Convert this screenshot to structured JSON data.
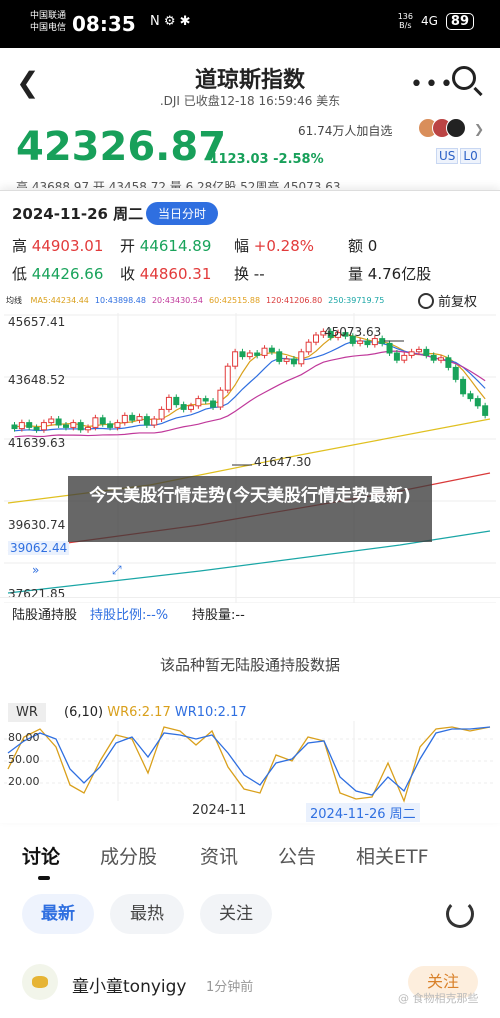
{
  "status_bar": {
    "carrier1": "中国联通",
    "carrier2": "中国电信",
    "time": "08:35",
    "icons": "N ⚙ ✱",
    "net_speed_top": "136",
    "net_speed_bottom": "B/s",
    "signal": "4G",
    "battery": "89"
  },
  "header": {
    "title": "道琼斯指数",
    "subtitle": ".DJI 已收盘12-18 16:59:46 美东"
  },
  "quote": {
    "price": "42326.87",
    "change": "-1123.03 -2.58%",
    "watchers": "61.74万人加自选",
    "markets": [
      "US",
      "L0"
    ],
    "ticker": "高 43688.97   开 43458.72   量 6.28亿股   52周高 45073.63"
  },
  "detail": {
    "date": "2024-11-26 周二",
    "timeshare_button": "当日分时",
    "high_label": "高",
    "high": "44903.01",
    "open_label": "开",
    "open": "44614.89",
    "amp_label": "幅",
    "amp": "+0.28%",
    "amount_label": "额",
    "amount": "0",
    "low_label": "低",
    "low": "44426.66",
    "close_label": "收",
    "close": "44860.31",
    "turnover_label": "换",
    "turnover": "--",
    "volume_label": "量",
    "volume": "4.76亿股"
  },
  "ma_bar": {
    "label": "均线",
    "items": [
      {
        "text": "MA5:44234.44",
        "color": "#d9a01c"
      },
      {
        "text": "10:43898.48",
        "color": "#2f6fe0"
      },
      {
        "text": "20:43430.54",
        "color": "#c0399b"
      },
      {
        "text": "60:42515.88",
        "color": "#e0a020"
      },
      {
        "text": "120:41206.80",
        "color": "#d93a3a"
      },
      {
        "text": "250:39719.75",
        "color": "#1aa6a6"
      }
    ],
    "restore_label": "前复权"
  },
  "kline": {
    "y_labels": [
      "45657.41",
      "43648.52",
      "41639.63",
      "39630.74",
      "39062.44",
      "37621.85"
    ],
    "max_marker": "45073.63",
    "min_marker": "41647.30"
  },
  "overlay_text": "今天美股行情走势(今天美股行情走势最新)",
  "hk_connect": {
    "label": "陆股通持股",
    "ratio": "持股比例:--%",
    "amount": "持股量:--",
    "message": "该品种暂无陆股通持股数据"
  },
  "wr": {
    "tag": "WR",
    "params": "(6,10)",
    "wr6": "WR6:2.17",
    "wr10": "WR10:2.17",
    "y_labels": [
      "80.00",
      "50.00",
      "20.00"
    ],
    "x_label": "2024-11",
    "x_highlight": "2024-11-26 周二"
  },
  "tabs": [
    "讨论",
    "成分股",
    "资讯",
    "公告",
    "相关ETF"
  ],
  "subtabs": [
    "最新",
    "最热",
    "关注"
  ],
  "post": {
    "user": "童小童tonyigy",
    "time": "1分钟前",
    "follow": "关注"
  },
  "watermark": "@ 食物相克那些"
}
